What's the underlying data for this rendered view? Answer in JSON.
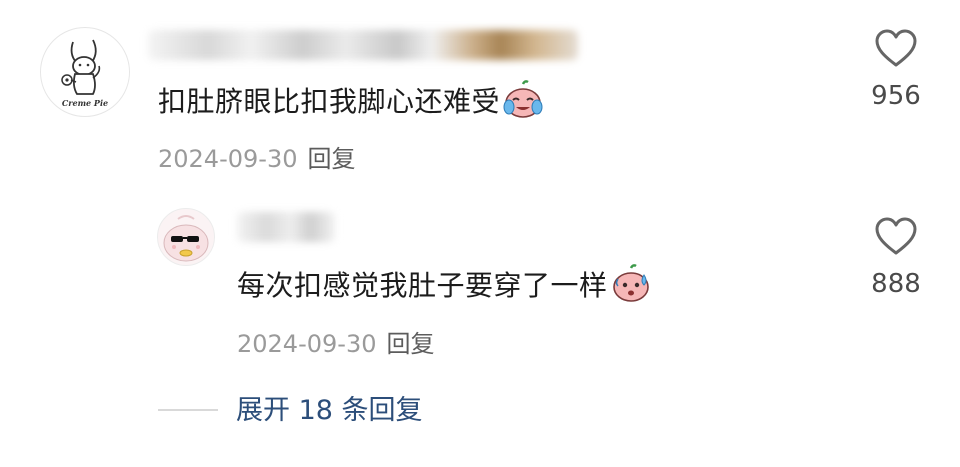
{
  "main_comment": {
    "avatar_text": "Creme Pie",
    "text": "扣肚脐眼比扣我脚心还难受",
    "emoji": "crying-face-emoji",
    "date": "2024-09-30",
    "reply_label": "回复",
    "likes": "956"
  },
  "reply_comment": {
    "text": "每次扣感觉我肚子要穿了一样",
    "emoji": "sweating-face-emoji",
    "date": "2024-09-30",
    "reply_label": "回复",
    "likes": "888"
  },
  "expand": {
    "label": "展开 18 条回复"
  },
  "colors": {
    "link": "#2c4e7a",
    "meta": "#9a9a9a",
    "text": "#1c1c1c"
  }
}
